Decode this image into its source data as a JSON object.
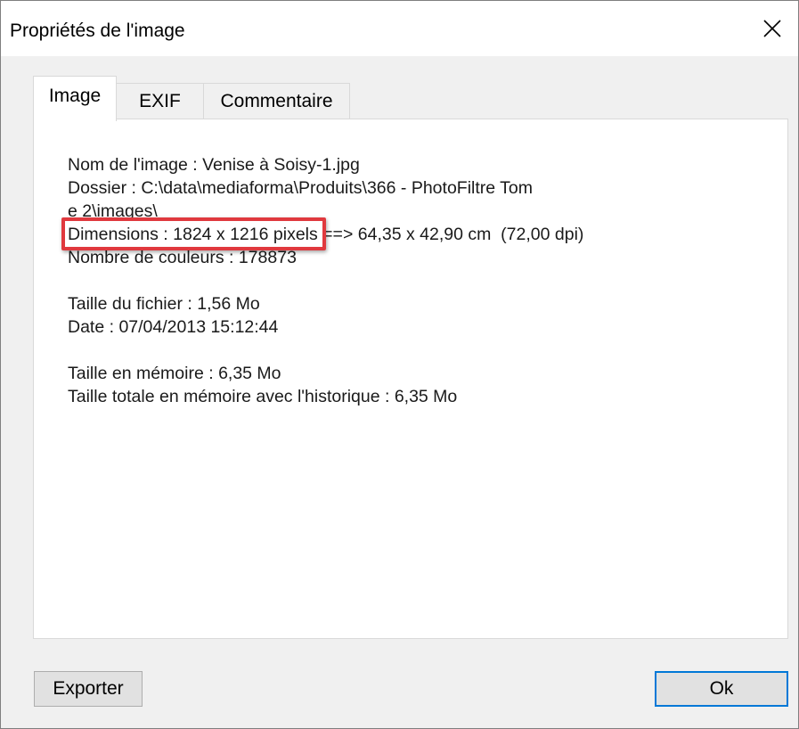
{
  "window": {
    "title": "Propriétés de l'image",
    "close_glyph": "✕"
  },
  "tabs": [
    {
      "label": "Image",
      "active": true
    },
    {
      "label": "EXIF",
      "active": false
    },
    {
      "label": "Commentaire",
      "active": false
    }
  ],
  "info": {
    "name_line": "Nom de l'image : Venise à Soisy-1.jpg",
    "folder_line1": "Dossier : C:\\data\\mediaforma\\Produits\\366 - PhotoFiltre Tom",
    "folder_line2": "e 2\\images\\",
    "dimensions_highlight": "Dimensions : 1824 x 1216 pixels",
    "dimensions_rest": " ==> 64,35 x 42,90 cm  (72,00 dpi)",
    "colors_line": "Nombre de couleurs : 178873",
    "filesize_line": "Taille du fichier : 1,56 Mo",
    "date_line": "Date : 07/04/2013 15:12:44",
    "memory_line": "Taille en mémoire : 6,35 Mo",
    "total_memory_line": "Taille totale en mémoire avec l'historique : 6,35 Mo"
  },
  "buttons": {
    "export_label": "Exporter",
    "ok_label": "Ok"
  },
  "colors": {
    "highlight_box": "#e0393e",
    "default_button_border": "#0078d7"
  }
}
